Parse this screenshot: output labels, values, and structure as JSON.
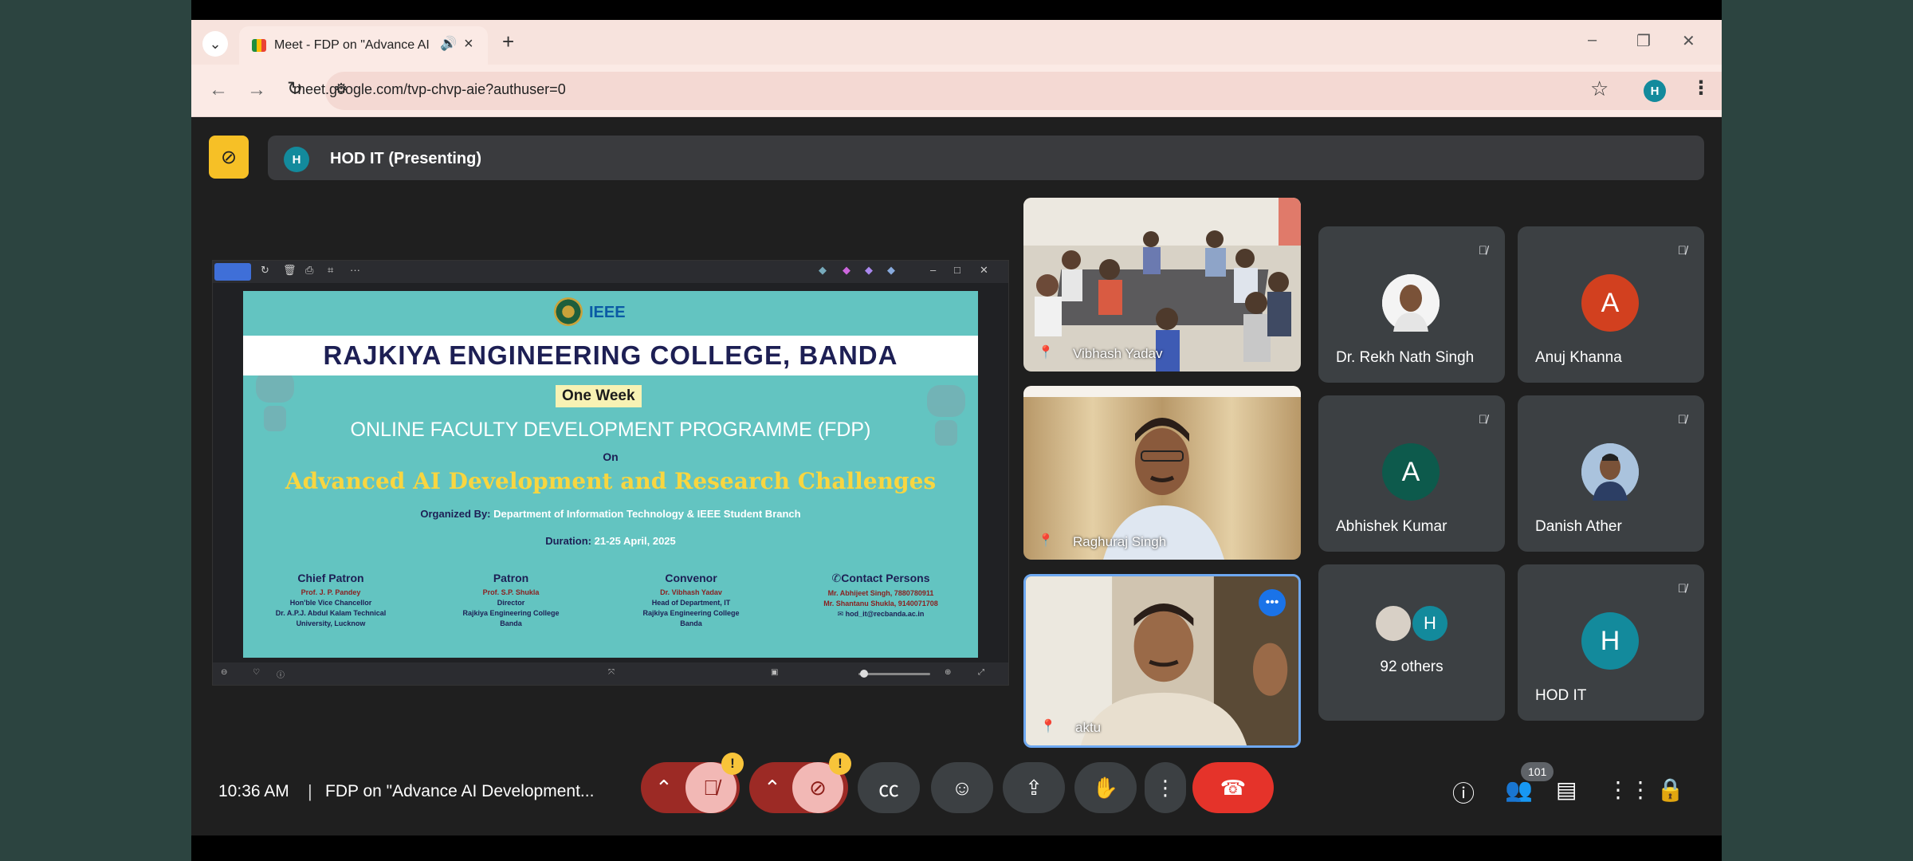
{
  "browser": {
    "tab_title": "Meet - FDP on \"Advance AI",
    "url": "meet.google.com/tvp-chvp-aie?authuser=0",
    "profile_initial": "H"
  },
  "meet": {
    "presenting_label": "HOD IT (Presenting)",
    "presenter_initial": "H",
    "clock": "10:36 AM",
    "meeting_title": "FDP on \"Advance AI Development...",
    "participants_count": "101"
  },
  "slide": {
    "college": "RAJKIYA ENGINEERING COLLEGE, BANDA",
    "ieee": "IEEE",
    "one_week": "One Week",
    "programme": "ONLINE FACULTY DEVELOPMENT PROGRAMME (FDP)",
    "on": "On",
    "topic": "Advanced AI Development and Research Challenges",
    "organized_label": "Organized By:",
    "organized_value": "Department of Information Technology & IEEE Student Branch",
    "duration_label": "Duration:",
    "duration_value": "21-25 April, 2025",
    "columns": [
      {
        "heading": "Chief Patron",
        "lines": [
          "Prof. J. P. Pandey",
          "Hon'ble Vice Chancellor",
          "Dr. A.P.J. Abdul Kalam Technical",
          "University, Lucknow"
        ]
      },
      {
        "heading": "Patron",
        "lines": [
          "Prof. S.P. Shukla",
          "Director",
          "Rajkiya Engineering College",
          "Banda"
        ]
      },
      {
        "heading": "Convenor",
        "lines": [
          "Dr. Vibhash Yadav",
          "Head of Department, IT",
          "Rajkiya Engineering College",
          "Banda"
        ]
      },
      {
        "heading": "Contact Persons",
        "lines": [
          "Mr. Abhijeet Singh, 7880780911",
          "Mr. Shantanu Shukla, 9140071708",
          "hod_it@recbanda.ac.in"
        ]
      }
    ]
  },
  "video_tiles": [
    {
      "name": "Vibhash Yadav"
    },
    {
      "name": "Raghuraj Singh"
    },
    {
      "name": "aktu"
    }
  ],
  "participants": [
    {
      "name": "Dr. Rekh Nath Singh",
      "initial": "",
      "color": "#ffffff"
    },
    {
      "name": "Anuj Khanna",
      "initial": "A",
      "color": "#d2401f"
    },
    {
      "name": "Abhishek Kumar",
      "initial": "A",
      "color": "#0d5a4c"
    },
    {
      "name": "Danish Ather",
      "initial": "",
      "color": "#8fb0d4"
    },
    {
      "name": "92 others",
      "initial": "H",
      "color": "#138a9c"
    },
    {
      "name": "HOD IT",
      "initial": "H",
      "color": "#138a9c"
    }
  ],
  "icons": [
    "volume-icon",
    "close-icon",
    "plus-icon",
    "back-icon",
    "forward-icon",
    "reload-icon",
    "site-settings-icon",
    "star-icon",
    "menu-icon",
    "camera-off-icon",
    "mic-off-icon",
    "video-off-icon",
    "captions-icon",
    "emoji-icon",
    "present-icon",
    "raise-hand-icon",
    "more-options-icon",
    "hang-up-icon",
    "info-icon",
    "people-icon",
    "chat-icon",
    "activities-icon",
    "host-controls-icon"
  ]
}
